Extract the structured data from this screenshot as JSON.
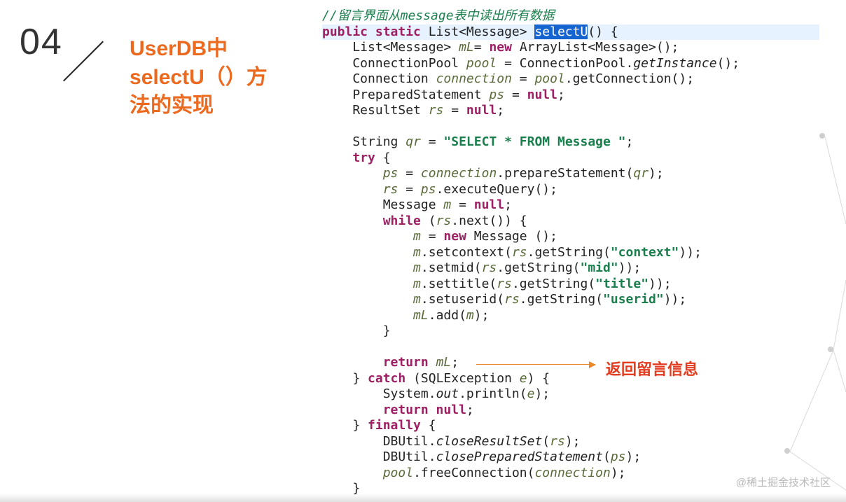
{
  "slide": {
    "number": "04"
  },
  "heading": {
    "line1": "UserDB中",
    "line2": "selectU（）方",
    "line3": "法的实现"
  },
  "code": {
    "comment1": "//留言界面从message表中读出所有数据",
    "sig_pre": "public static ",
    "sig_ret": "List<Message> ",
    "sig_name_sel": "selectU",
    "sig_post": "() {",
    "l3a": "    List<Message> ",
    "l3b": "mL",
    "l3c": "= ",
    "l3d": "new ",
    "l3e": "ArrayList<Message>();",
    "l4a": "    ConnectionPool ",
    "l4b": "pool",
    "l4c": " = ConnectionPool.",
    "l4d": "getInstance",
    "l4e": "();",
    "l5a": "    Connection ",
    "l5b": "connection",
    "l5c": " = ",
    "l5d": "pool",
    "l5e": ".getConnection();",
    "l6a": "    PreparedStatement ",
    "l6b": "ps",
    "l6c": " = ",
    "l6d": "null",
    "l6e": ";",
    "l7a": "    ResultSet ",
    "l7b": "rs",
    "l7c": " = ",
    "l7d": "null",
    "l7e": ";",
    "blank1": "",
    "l9a": "    String ",
    "l9b": "qr",
    "l9c": " = ",
    "l9d": "\"SELECT * FROM Message \"",
    "l9e": ";",
    "l10a": "    ",
    "l10b": "try",
    "l10c": " {",
    "l11a": "        ",
    "l11b": "ps",
    "l11c": " = ",
    "l11d": "connection",
    "l11e": ".prepareStatement(",
    "l11f": "qr",
    "l11g": ");",
    "l12a": "        ",
    "l12b": "rs",
    "l12c": " = ",
    "l12d": "ps",
    "l12e": ".executeQuery();",
    "l13a": "        Message ",
    "l13b": "m",
    "l13c": " = ",
    "l13d": "null",
    "l13e": ";",
    "l14a": "        ",
    "l14b": "while",
    "l14c": " (",
    "l14d": "rs",
    "l14e": ".next()) {",
    "l15a": "            ",
    "l15b": "m",
    "l15c": " = ",
    "l15d": "new ",
    "l15e": "Message ();",
    "l16a": "            ",
    "l16b": "m",
    "l16c": ".setcontext(",
    "l16d": "rs",
    "l16e": ".getString(",
    "l16f": "\"context\"",
    "l16g": "));",
    "l17a": "            ",
    "l17b": "m",
    "l17c": ".setmid(",
    "l17d": "rs",
    "l17e": ".getString(",
    "l17f": "\"mid\"",
    "l17g": "));",
    "l18a": "            ",
    "l18b": "m",
    "l18c": ".settitle(",
    "l18d": "rs",
    "l18e": ".getString(",
    "l18f": "\"title\"",
    "l18g": "));",
    "l19a": "            ",
    "l19b": "m",
    "l19c": ".setuserid(",
    "l19d": "rs",
    "l19e": ".getString(",
    "l19f": "\"userid\"",
    "l19g": "));",
    "l20a": "            ",
    "l20b": "mL",
    "l20c": ".add(",
    "l20d": "m",
    "l20e": ");",
    "l21": "        }",
    "blank2": "",
    "l23a": "        ",
    "l23b": "return ",
    "l23c": "mL",
    "l23d": ";",
    "l24a": "    } ",
    "l24b": "catch",
    "l24c": " (SQLException ",
    "l24d": "e",
    "l24e": ") {",
    "l25a": "        System.",
    "l25b": "out",
    "l25c": ".println(",
    "l25d": "e",
    "l25e": ");",
    "l26a": "        ",
    "l26b": "return null",
    "l26c": ";",
    "l27a": "    } ",
    "l27b": "finally",
    "l27c": " {",
    "l28a": "        DBUtil.",
    "l28b": "closeResultSet",
    "l28c": "(",
    "l28d": "rs",
    "l28e": ");",
    "l29a": "        DBUtil.",
    "l29b": "closePreparedStatement",
    "l29c": "(",
    "l29d": "ps",
    "l29e": ");",
    "l30a": "        ",
    "l30b": "pool",
    "l30c": ".freeConnection(",
    "l30d": "connection",
    "l30e": ");",
    "l31": "    }"
  },
  "annotation": {
    "text": "返回留言信息"
  },
  "watermark": {
    "text": "@稀土掘金技术社区"
  }
}
